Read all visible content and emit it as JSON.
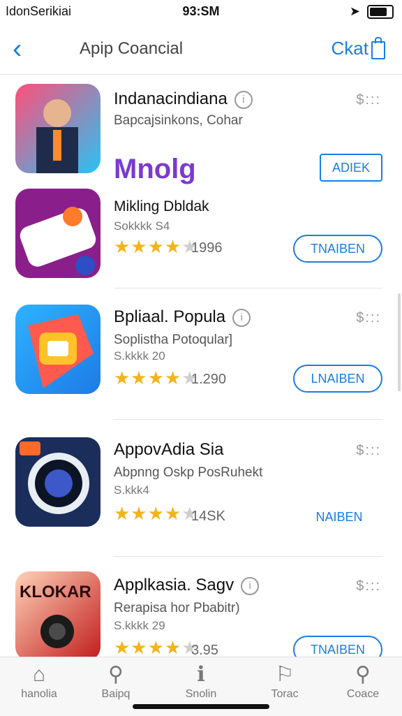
{
  "status": {
    "carrier": "IdonSerikiai",
    "time": "93:SM"
  },
  "nav": {
    "title": "Apip Coancial",
    "cart_label": "Ckat"
  },
  "apps": [
    {
      "name": "Indanacindiana",
      "subtitle": "Bapcajsinkons, Cohar",
      "meta": "",
      "stars": "",
      "dim": "",
      "count": "",
      "price": "$:::",
      "button": "ADIEK",
      "logo_text": "Mnolg"
    },
    {
      "name": "Mikling Dbldak",
      "subtitle": "",
      "meta": "Sokkkk S4",
      "stars": "★★★★",
      "dim": "★",
      "count": "1996",
      "price": "",
      "button": "TNAIBEN"
    },
    {
      "name": "Bpliaal. Popula",
      "subtitle": "Soplistha Potoqular]",
      "meta": "S.kkkk 20",
      "stars": "★★★★",
      "dim": "★",
      "count": "1.290",
      "price": "$:::",
      "button": "LNAIBEN"
    },
    {
      "name": "AppovAdia Sia",
      "subtitle": "Abpnng Oskp PosRuhekt",
      "meta": "S.kkk4",
      "stars": "★★★★",
      "dim": "★",
      "count": "14SK",
      "price": "$:::",
      "button": "NAIBEN"
    },
    {
      "name": "Applkasia. Sagv",
      "subtitle": "Rerapisa hor Pbabitr)",
      "meta": "S.kkkk 29",
      "stars": "★★★★",
      "dim": "★",
      "count": "3.95",
      "price": "$:::",
      "button": "TNAIBEN",
      "icon_text": "KLOKAR"
    }
  ],
  "tabs": [
    {
      "label": "hanolia",
      "icon": "house-icon",
      "glyph": "⌂"
    },
    {
      "label": "Baipq",
      "icon": "search-icon",
      "glyph": "⚲"
    },
    {
      "label": "Snolin",
      "icon": "info-icon",
      "glyph": "ℹ"
    },
    {
      "label": "Torac",
      "icon": "tag-icon",
      "glyph": "⚐"
    },
    {
      "label": "Coace",
      "icon": "search-icon",
      "glyph": "⚲"
    }
  ],
  "colors": {
    "accent": "#1a7de3",
    "star": "#f3b31a"
  }
}
